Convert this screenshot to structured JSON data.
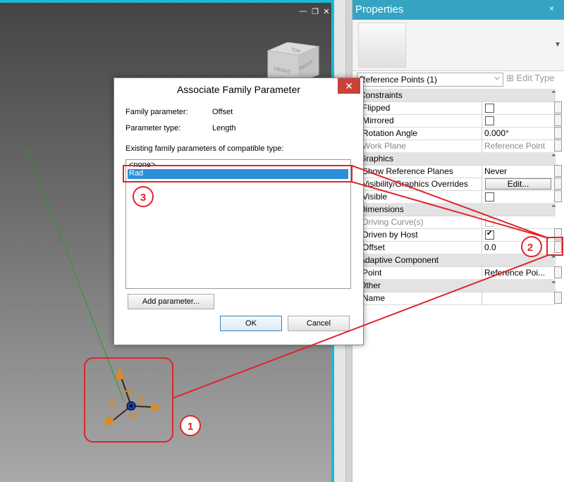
{
  "properties": {
    "title": "Properties",
    "close": "×",
    "selector": "Reference Points (1)",
    "edit_type": "Edit Type",
    "categories": {
      "constraints": "Constraints",
      "graphics": "Graphics",
      "dimensions": "Dimensions",
      "adaptive": "Adaptive Component",
      "other": "Other"
    },
    "rows": {
      "flipped": "Flipped",
      "mirrored": "Mirrored",
      "rotation": "Rotation Angle",
      "rotation_val": "0.000°",
      "workplane": "Work Plane",
      "workplane_val": "Reference Point",
      "show_ref": "Show Reference Planes",
      "show_ref_val": "Never",
      "vg": "Visibility/Graphics Overrides",
      "vg_btn": "Edit...",
      "visible": "Visible",
      "driving": "Driving Curve(s)",
      "driven": "Driven by Host",
      "offset": "Offset",
      "offset_val": "0.0",
      "point": "Point",
      "point_val": "Reference Poi...",
      "name": "Name"
    }
  },
  "dialog": {
    "title": "Associate Family Parameter",
    "close": "✕",
    "family_param_label": "Family parameter:",
    "family_param_value": "Offset",
    "param_type_label": "Parameter type:",
    "param_type_value": "Length",
    "existing_label": "Existing family parameters of compatible type:",
    "items": [
      "<none>",
      "Rad"
    ],
    "add_button": "Add parameter...",
    "ok": "OK",
    "cancel": "Cancel"
  },
  "viewcube": {
    "top": "TOP",
    "front": "FRONT",
    "right": "RIGHT"
  },
  "annotations": [
    "1",
    "2",
    "3"
  ],
  "colors": {
    "accent": "#34a4c2",
    "annotation": "#e0252b",
    "selection": "#2e8fd8"
  }
}
